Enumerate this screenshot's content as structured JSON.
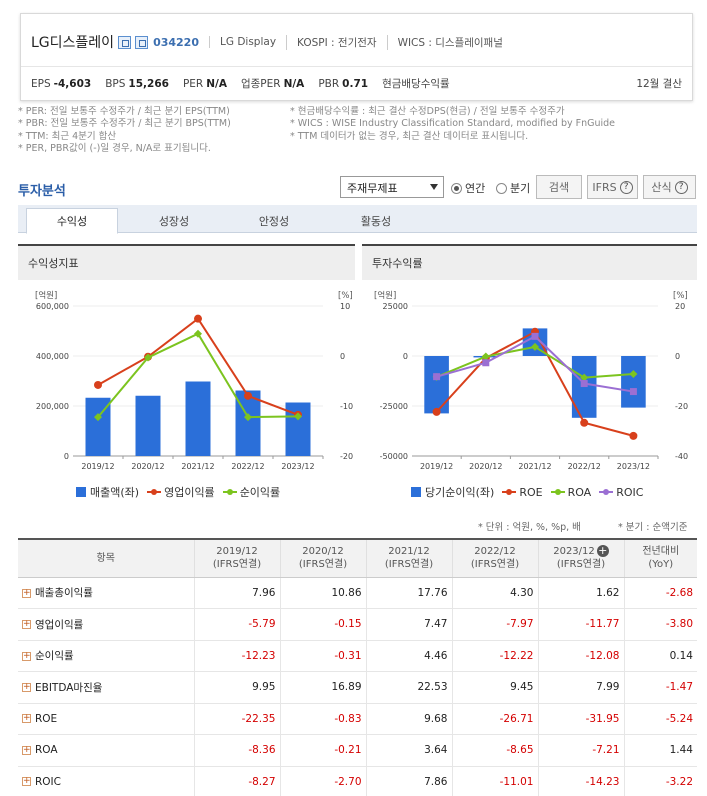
{
  "company": {
    "name": "LG디스플레이",
    "code": "034220",
    "english": "LG Display",
    "market": "KOSPI : 전기전자",
    "wics": "WICS : 디스플레이패널",
    "settlement": "12월 결산"
  },
  "stats": [
    {
      "label": "EPS",
      "value": "-4,603"
    },
    {
      "label": "BPS",
      "value": "15,266"
    },
    {
      "label": "PER",
      "value": "N/A"
    },
    {
      "label": "업종PER",
      "value": "N/A"
    },
    {
      "label": "PBR",
      "value": "0.71"
    },
    {
      "label": "현금배당수익률",
      "value": ""
    }
  ],
  "notes_left": [
    "* PER: 전일 보통주 수정주가 / 최근 분기 EPS(TTM)",
    "* PBR: 전일 보통주 수정주가 / 최근 분기 BPS(TTM)",
    "* TTM: 최근 4분기 합산",
    "* PER, PBR값이 (-)일 경우, N/A로 표기됩니다."
  ],
  "notes_right": [
    "* 현금배당수익률 : 최근 결산 수정DPS(현금) / 전일 보통주 수정주가",
    "* WICS : WISE Industry Classification Standard, modified by FnGuide",
    "* TTM 데이터가 없는 경우, 최근 결산 데이터로 표시됩니다."
  ],
  "analysis": {
    "title": "투자분석",
    "select_value": "주재무제표",
    "radio_annual": "연간",
    "radio_quarter": "분기",
    "search": "검색",
    "ifrs": "IFRS",
    "formula": "산식",
    "help": "?"
  },
  "tabs": [
    "수익성",
    "성장성",
    "안정성",
    "활동성"
  ],
  "chart1_title": "수익성지표",
  "chart2_title": "투자수익률",
  "chart_data": [
    {
      "type": "bar",
      "title": "수익성지표",
      "categories": [
        "2019/12",
        "2020/12",
        "2021/12",
        "2022/12",
        "2023/12"
      ],
      "y_left_unit": "[억원]",
      "y_right_unit": "[%]",
      "y_left_ticks": [
        "0",
        "200,000",
        "400,000",
        "600,000"
      ],
      "y_right_ticks": [
        "-20",
        "-10",
        "0",
        "10"
      ],
      "ylim_left": [
        0,
        600000
      ],
      "ylim_right": [
        -20,
        10
      ],
      "series": [
        {
          "name": "매출액(좌)",
          "type": "bar",
          "axis": "left",
          "color": "#2b6fd9",
          "values": [
            233000,
            241000,
            298000,
            262000,
            214000
          ]
        },
        {
          "name": "영업이익률",
          "type": "line",
          "axis": "right",
          "color": "#d8401c",
          "values": [
            -5.79,
            -0.15,
            7.47,
            -7.97,
            -11.77
          ]
        },
        {
          "name": "순이익률",
          "type": "line",
          "axis": "right",
          "color": "#7cc41f",
          "values": [
            -12.23,
            -0.31,
            4.46,
            -12.22,
            -12.08
          ]
        }
      ]
    },
    {
      "type": "bar",
      "title": "투자수익률",
      "categories": [
        "2019/12",
        "2020/12",
        "2021/12",
        "2022/12",
        "2023/12"
      ],
      "y_left_unit": "[억원]",
      "y_right_unit": "[%]",
      "y_left_ticks": [
        "-50000",
        "-25000",
        "0",
        "25000"
      ],
      "y_right_ticks": [
        "-40",
        "-20",
        "0",
        "20"
      ],
      "ylim_left": [
        -50000,
        25000
      ],
      "ylim_right": [
        -40,
        20
      ],
      "series": [
        {
          "name": "당기순이익(좌)",
          "type": "bar",
          "axis": "left",
          "color": "#2b6fd9",
          "values": [
            -28700,
            -710,
            13800,
            -30900,
            -25800
          ]
        },
        {
          "name": "ROE",
          "type": "line",
          "axis": "right",
          "color": "#d8401c",
          "values": [
            -22.35,
            -0.83,
            9.68,
            -26.71,
            -31.95
          ]
        },
        {
          "name": "ROA",
          "type": "line",
          "axis": "right",
          "color": "#7cc41f",
          "values": [
            -8.36,
            -0.21,
            3.64,
            -8.65,
            -7.21
          ]
        },
        {
          "name": "ROIC",
          "type": "line",
          "axis": "right",
          "color": "#9b6fd3",
          "values": [
            -8.27,
            -2.7,
            7.86,
            -11.01,
            -14.23
          ]
        }
      ]
    }
  ],
  "unit_note": "* 단위 : 억원, %, %p, 배",
  "quarter_note": "* 분기 : 순액기준",
  "table": {
    "headers": [
      "항목",
      "2019/12",
      "2020/12",
      "2021/12",
      "2022/12",
      "2023/12",
      "전년대비"
    ],
    "subheaders": [
      "",
      "(IFRS연결)",
      "(IFRS연결)",
      "(IFRS연결)",
      "(IFRS연결)",
      "(IFRS연결)",
      "(YoY)"
    ],
    "rows": [
      {
        "label": "매출총이익률",
        "values": [
          "7.96",
          "10.86",
          "17.76",
          "4.30",
          "1.62",
          "-2.68"
        ]
      },
      {
        "label": "영업이익률",
        "values": [
          "-5.79",
          "-0.15",
          "7.47",
          "-7.97",
          "-11.77",
          "-3.80"
        ]
      },
      {
        "label": "순이익률",
        "values": [
          "-12.23",
          "-0.31",
          "4.46",
          "-12.22",
          "-12.08",
          "0.14"
        ]
      },
      {
        "label": "EBITDA마진율",
        "values": [
          "9.95",
          "16.89",
          "22.53",
          "9.45",
          "7.99",
          "-1.47"
        ]
      },
      {
        "label": "ROE",
        "values": [
          "-22.35",
          "-0.83",
          "9.68",
          "-26.71",
          "-31.95",
          "-5.24"
        ]
      },
      {
        "label": "ROA",
        "values": [
          "-8.36",
          "-0.21",
          "3.64",
          "-8.65",
          "-7.21",
          "1.44"
        ]
      },
      {
        "label": "ROIC",
        "values": [
          "-8.27",
          "-2.70",
          "7.86",
          "-11.01",
          "-14.23",
          "-3.22"
        ]
      }
    ]
  }
}
